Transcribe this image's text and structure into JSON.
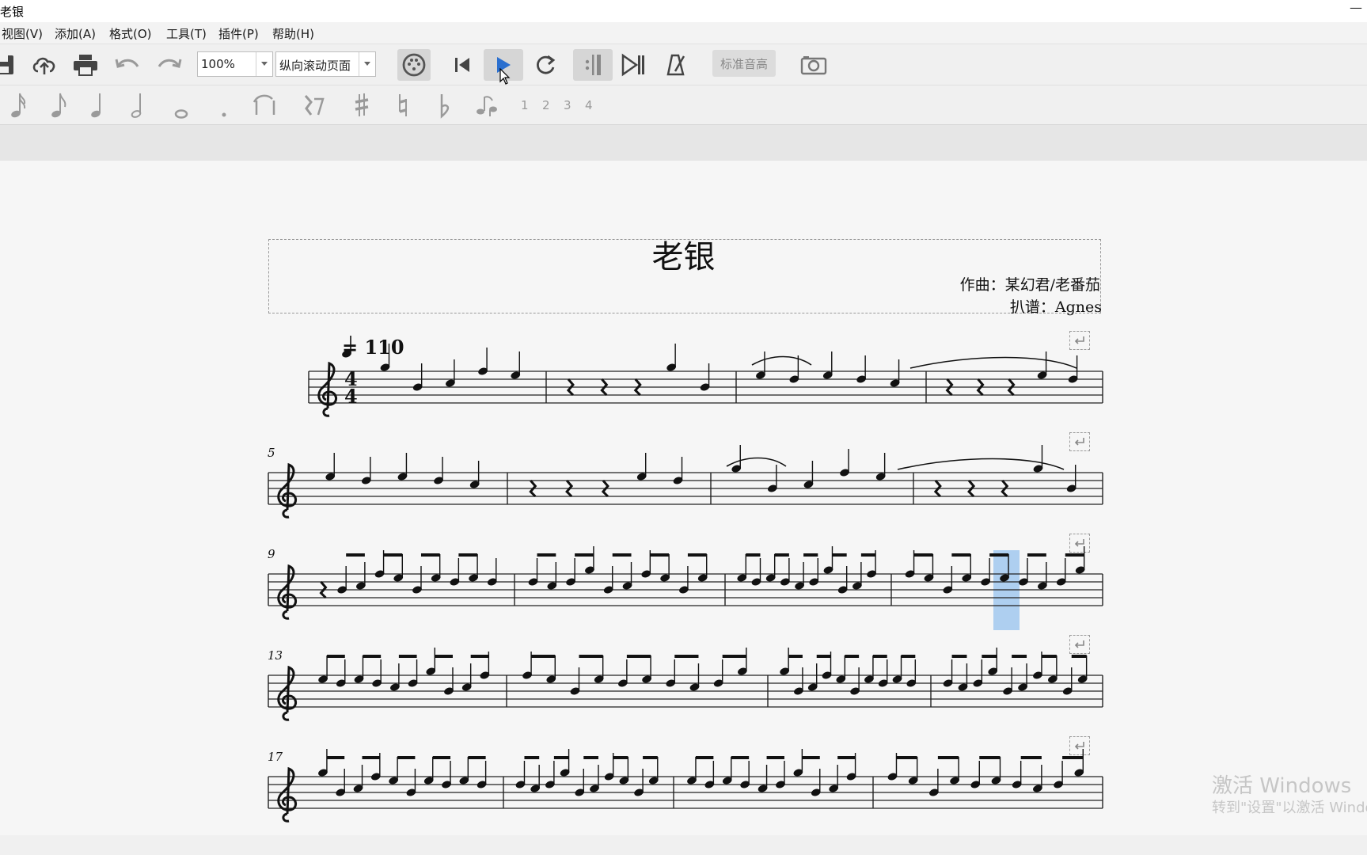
{
  "window": {
    "title": "老银",
    "minimize_glyph": "—"
  },
  "menu": [
    "视图(V)",
    "添加(A)",
    "格式(O)",
    "工具(T)",
    "插件(P)",
    "帮助(H)"
  ],
  "toolbar": {
    "zoom_value": "100%",
    "view_mode": "纵向滚动页面",
    "standard_pitch_label": "标准音高",
    "icons": [
      "save-icon",
      "upload-icon",
      "print-icon",
      "undo-icon",
      "redo-icon",
      "midi-input-icon",
      "rewind-icon",
      "play-icon",
      "loop-icon",
      "play-repeats-icon",
      "pan-score-icon",
      "metronome-icon",
      "camera-icon"
    ],
    "play_color": "#2a6fcf"
  },
  "note_input": {
    "icons": [
      "sixteenth-note-icon",
      "eighth-note-icon",
      "quarter-note-icon",
      "half-note-icon",
      "whole-note-icon",
      "dot-icon",
      "tie-icon",
      "rest-icon",
      "sharp-icon",
      "natural-icon",
      "flat-icon",
      "flip-icon"
    ],
    "voices": [
      "1",
      "2",
      "3",
      "4"
    ]
  },
  "score": {
    "title": "老银",
    "composer": "作曲：某幻君/老番茄",
    "arranger": "扒谱：Agnes",
    "tempo": "= 110",
    "time_signature": {
      "top": "4",
      "bottom": "4"
    },
    "measure_numbers": [
      "5",
      "9",
      "13",
      "17"
    ],
    "selection_color": "#aecff0"
  },
  "watermark": {
    "line1": "激活 Windows",
    "line2": "转到\"设置\"以激活 Windows。"
  }
}
